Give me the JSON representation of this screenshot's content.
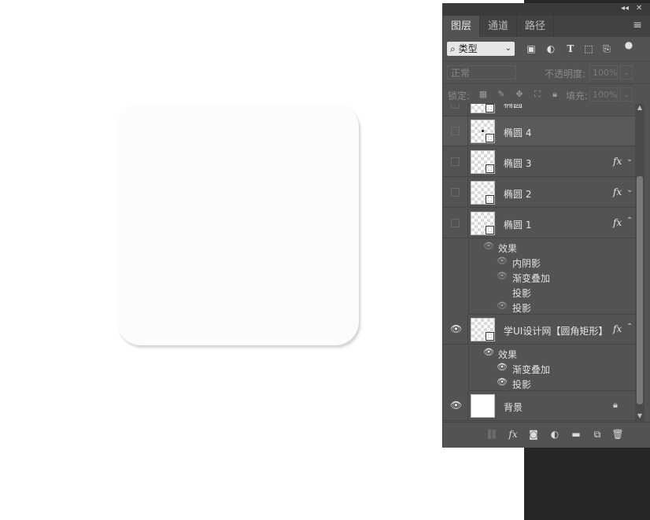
{
  "panel": {
    "tabs": [
      {
        "label": "图层",
        "active": true
      },
      {
        "label": "通道",
        "active": false
      },
      {
        "label": "路径",
        "active": false
      }
    ],
    "filter": {
      "icon": "search-icon",
      "value": "类型"
    },
    "blend_mode": "正常",
    "opacity_label": "不透明度:",
    "opacity_value": "100%",
    "lock_label": "锁定:",
    "fill_label": "填充:",
    "fill_value": "100%"
  },
  "layers": {
    "partial_top": {
      "name": "椭圆"
    },
    "items": [
      {
        "name": "椭圆 4",
        "visible": false,
        "fx": false
      },
      {
        "name": "椭圆 3",
        "visible": false,
        "fx": true
      },
      {
        "name": "椭圆 2",
        "visible": false,
        "fx": true
      },
      {
        "name": "椭圆 1",
        "visible": false,
        "fx": true,
        "effects_label": "效果",
        "effects": [
          "内阴影",
          "渐变叠加",
          "投影",
          "投影"
        ]
      },
      {
        "name": "学UI设计网【圆角矩形】",
        "visible": true,
        "fx": true,
        "effects_label": "效果",
        "effects": [
          "渐变叠加",
          "投影"
        ]
      },
      {
        "name": "背景",
        "visible": true,
        "locked": true
      }
    ],
    "fx_label": "fx"
  },
  "bottom_bar": {
    "icons": [
      "link-icon",
      "fx-icon",
      "mask-icon",
      "adjustment-icon",
      "folder-icon",
      "new-layer-icon",
      "trash-icon"
    ],
    "fx_label": "fx"
  },
  "colors": {
    "panel_bg": "#535353",
    "canvas_bg": "#ffffff",
    "shape_fill": "#fcfcfc"
  }
}
